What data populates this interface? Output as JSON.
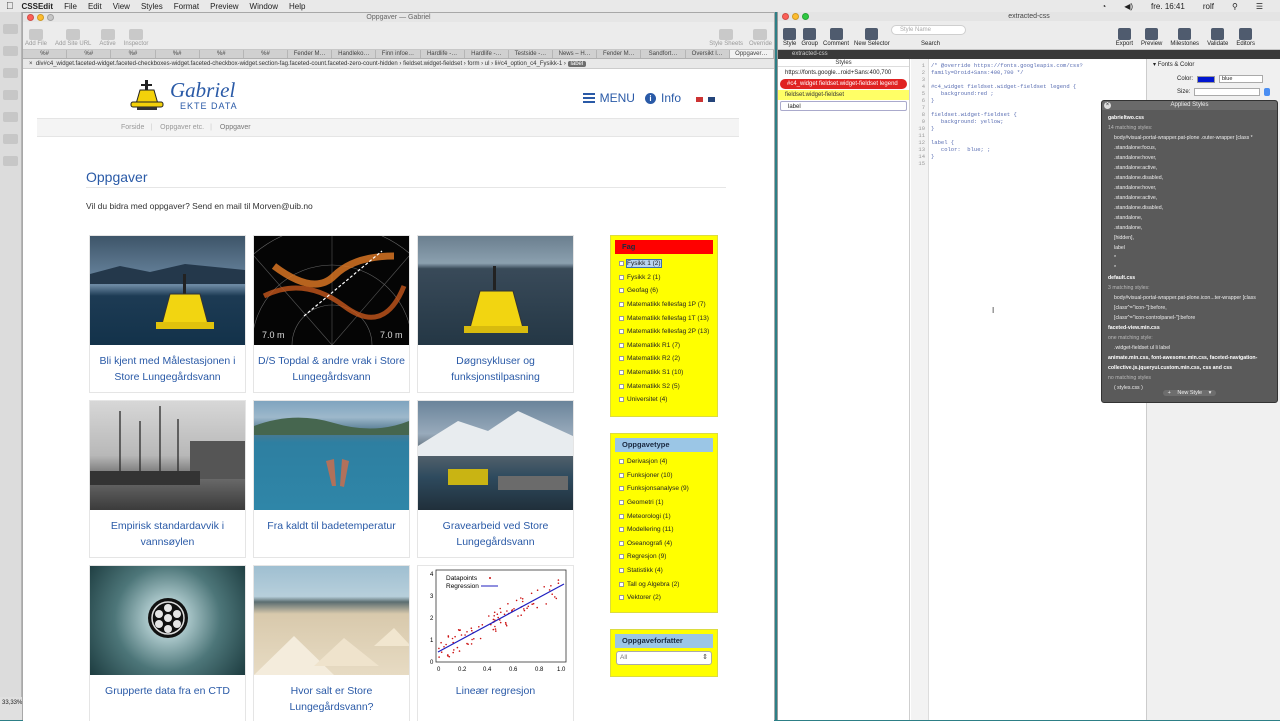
{
  "menubar": {
    "apple": "",
    "app_name": "CSSEdit",
    "items": [
      "File",
      "Edit",
      "View",
      "Styles",
      "Format",
      "Preview",
      "Window",
      "Help"
    ],
    "status_right": [
      "fre. 16:41",
      "rolf"
    ]
  },
  "browser": {
    "window_title": "Oppgaver — Gabriel",
    "toolbar": {
      "add_file": "Add File",
      "add_site_url": "Add Site URL",
      "active": "Active",
      "inspector": "Inspector",
      "style_sheets": "Style Sheets",
      "override": "Override",
      "badge_count": "13"
    },
    "tabs": [
      "%#",
      "%#",
      "%#",
      "%#",
      "%#",
      "%#",
      "Fender M…",
      "Handleko…",
      "Finn infoe…",
      "Hardlife -…",
      "Hardlife -…",
      "Testside -…",
      "News – H…",
      "Fender M…",
      "Sandfort…",
      "Oversikt l…",
      "Oppgaver…"
    ],
    "path": [
      "div#c4_widget.faceted-widget.faceted-checkboxes-widget.faceted-checkbox-widget.section-fag.faceted-count.faceted-zero-count-hidden",
      "fieldset.widget-fieldset",
      "form",
      "ul",
      "li#c4_option_c4_Fysikk-1",
      "label"
    ],
    "zoom": "33,33%"
  },
  "site": {
    "logo_title": "Gabriel",
    "logo_subtitle": "EKTE DATA",
    "nav": {
      "menu": "MENU",
      "info": "Info"
    },
    "breadcrumbs": [
      "Forside",
      "Oppgaver etc.",
      "Oppgaver"
    ],
    "page_title": "Oppgaver",
    "intro": "Vil du bidra med oppgaver? Send en mail til Morven@uib.no",
    "cards": [
      {
        "title": "Bli kjent med Målestasjonen i Store Lungegårdsvann"
      },
      {
        "title": "D/S Topdal & andre vrak i Store Lungegårdsvann",
        "overlay_left": "7.0 m",
        "overlay_right": "7.0 m"
      },
      {
        "title": "Døgnsykluser og funksjonstilpasning"
      },
      {
        "title": "Empirisk standardavvik i vannsøylen"
      },
      {
        "title": "Fra kaldt til badetemperatur"
      },
      {
        "title": "Gravearbeid ved Store Lungegårdsvann"
      },
      {
        "title": "Grupperte data fra en CTD"
      },
      {
        "title": "Hvor salt er Store Lungegårdsvann?"
      },
      {
        "title": "Lineær regresjon",
        "legend": [
          "Datapoints",
          "Regression"
        ],
        "yticks": [
          "0",
          "1",
          "2",
          "3",
          "4"
        ],
        "xticks": [
          "0",
          "0.2",
          "0.4",
          "0.6",
          "0.8",
          "1.0"
        ]
      }
    ],
    "facets": {
      "fag": {
        "header": "Fag",
        "items": [
          "Fysikk 1 (2)",
          "Fysikk 2 (1)",
          "Geofag (6)",
          "Matematikk fellesfag 1P (7)",
          "Matematikk fellesfag 1T (13)",
          "Matematikk fellesfag 2P (13)",
          "Matematikk R1 (7)",
          "Matematikk R2 (2)",
          "Matematikk S1 (10)",
          "Matematikk S2 (5)",
          "Universitet (4)"
        ]
      },
      "oppgavetype": {
        "header": "Oppgavetype",
        "items": [
          "Derivasjon (4)",
          "Funksjoner (10)",
          "Funksjonsanalyse (9)",
          "Geometri (1)",
          "Meteorologi (1)",
          "Modellering (11)",
          "Oseanografi (4)",
          "Regresjon (9)",
          "Statistikk (4)",
          "Tall og Algebra (2)",
          "Vektorer (2)"
        ]
      },
      "oppgaveforfatter": {
        "header": "Oppgaveforfatter",
        "select_value": "All"
      }
    }
  },
  "editor": {
    "window_title": "extracted-css",
    "toolbar": {
      "style": "Style",
      "group": "Group",
      "comment": "Comment",
      "new_selector": "New Selector",
      "search_placeholder": "Style Name",
      "search": "Search",
      "export": "Export",
      "preview": "Preview",
      "milestones": "Milestones",
      "validate": "Validate",
      "editors": "Editors"
    },
    "doc_tab": "extracted-css",
    "styles_header": "Styles",
    "styles": [
      "https://fonts.google...roid+Sans:400,700",
      "#c4_widget fieldset.widget-fieldset legend",
      "fieldset.widget-fieldset",
      "label"
    ],
    "line_numbers": [
      "1",
      "2",
      "3",
      "4",
      "5",
      "6",
      "7",
      "8",
      "9",
      "10",
      "11",
      "12",
      "13",
      "14",
      "15"
    ],
    "code": "/* @override https://fonts.googleapis.com/css?\nfamily=Droid+Sans:400,700 */\n\n#c4_widget fieldset.widget-fieldset legend {\n   background:red ;\n}\n\nfieldset.widget-fieldset {\n   background: yellow;\n}\n\nlabel {\n   color:  blue; ;\n}\n",
    "props": {
      "section": "Fonts & Color",
      "color_label": "Color:",
      "color_value": "blue",
      "size_label": "Size:",
      "color_hex": "#0015d0"
    },
    "applied": {
      "title": "Applied Styles",
      "files": [
        {
          "name": "gabrieltwo.css",
          "count": "14 matching styles:",
          "rules": [
            "body#visual-portal-wrapper.pat-plone .outer-wrapper [class *",
            ".standalone:focus,",
            ".standalone:hover,",
            ".standalone:active,",
            ".standalone.disabled,",
            ".standalone:hover,",
            ".standalone:active,",
            ".standalone.disabled,",
            ".standalone,",
            ".standalone,",
            "[hidden],",
            "label",
            "*",
            "*"
          ]
        },
        {
          "name": "default.css",
          "count": "3 matching styles:",
          "rules": [
            "body#visual-portal-wrapper.pat-plone.icon...ter-wrapper [class",
            "[class^=\"icon-\"]:before,",
            "[class^=\"icon-controlpanel-\"]:before"
          ]
        },
        {
          "name": "faceted-view.min.css",
          "count": "one matching style:",
          "rules": [
            ".widget-fieldset ul li label"
          ]
        },
        {
          "name": "animate.min.css, font-awesome.min.css, faceted-navigation-collective.js.jqueryui.custom.min.css, css and css",
          "count": "no matching styles",
          "rules": [
            "( styles.css )"
          ]
        }
      ],
      "new_style": "New Style"
    }
  }
}
